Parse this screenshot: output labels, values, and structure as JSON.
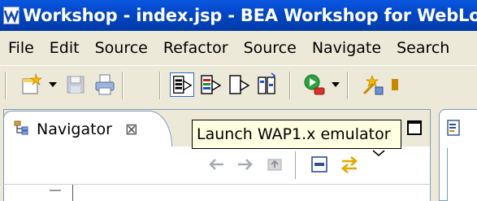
{
  "window": {
    "title": "Workshop - index.jsp - BEA Workshop for WebLo",
    "icon": "bea-workshop-icon"
  },
  "menu": {
    "items": [
      "File",
      "Edit",
      "Source",
      "Refactor",
      "Source",
      "Navigate",
      "Search"
    ]
  },
  "toolbar": {
    "icons": [
      "new-wizard-icon",
      "save-icon",
      "print-icon",
      "launch-wap-icon",
      "launch-wap-browser-icon",
      "launch-device-icon",
      "launch-config-icon",
      "run-icon",
      "open-type-icon"
    ]
  },
  "navigator": {
    "tab_label": "Navigator",
    "close_glyph": "⊠"
  },
  "tooltip": {
    "text": "Launch WAP1.x emulator"
  },
  "colors": {
    "title_bar": "#0347c7",
    "chrome": "#ece9d8",
    "tooltip_bg": "#ffffe1",
    "border": "#7f9db9"
  }
}
